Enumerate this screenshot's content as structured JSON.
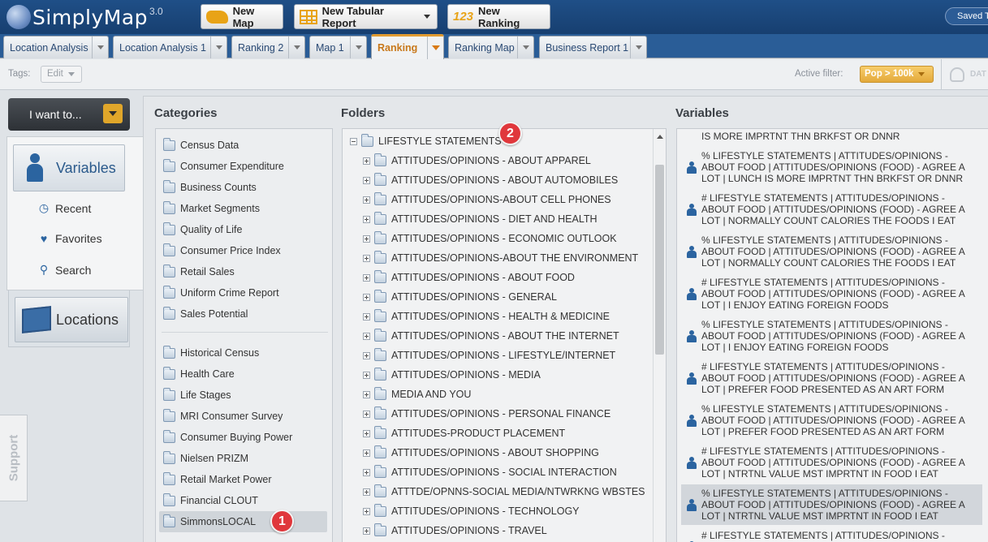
{
  "app": {
    "name": "SimplyMap",
    "version": "3.0"
  },
  "toolbar": {
    "new_map": "New Map",
    "new_tabular": "New Tabular Report",
    "new_ranking": "New Ranking",
    "new_ranking_icon_text": "123",
    "saved": "Saved T"
  },
  "tabs": [
    {
      "label": "Location Analysis"
    },
    {
      "label": "Location Analysis 1"
    },
    {
      "label": "Ranking 2"
    },
    {
      "label": "Map 1"
    },
    {
      "label": "Ranking"
    },
    {
      "label": "Ranking Map"
    },
    {
      "label": "Business Report 1"
    }
  ],
  "filterbar": {
    "tags_label": "Tags:",
    "tags_edit": "Edit",
    "active_filter_label": "Active filter:",
    "active_filter_value": "Pop > 100k",
    "data_label": "DAT"
  },
  "nav": {
    "i_want": "I want to...",
    "variables": "Variables",
    "recent": "Recent",
    "favorites": "Favorites",
    "search": "Search",
    "locations": "Locations",
    "support": "Support"
  },
  "columns": {
    "categories": "Categories",
    "folders": "Folders",
    "variables": "Variables"
  },
  "categories_top": [
    "Census Data",
    "Consumer Expenditure",
    "Business Counts",
    "Market Segments",
    "Quality of Life",
    "Consumer Price Index",
    "Retail Sales",
    "Uniform Crime Report",
    "Sales Potential"
  ],
  "categories_bottom": [
    "Historical Census",
    "Health Care",
    "Life Stages",
    "MRI Consumer Survey",
    "Consumer Buying Power",
    "Nielsen PRIZM",
    "Retail Market Power",
    "Financial CLOUT",
    "SimmonsLOCAL"
  ],
  "folders": {
    "root": "LIFESTYLE STATEMENTS",
    "items": [
      "ATTITUDES/OPINIONS - ABOUT APPAREL",
      "ATTITUDES/OPINIONS - ABOUT AUTOMOBILES",
      "ATTITUDES/OPINIONS-ABOUT CELL PHONES",
      "ATTITUDES/OPINIONS - DIET AND HEALTH",
      "ATTITUDES/OPINIONS - ECONOMIC OUTLOOK",
      "ATTITUDES/OPINIONS-ABOUT THE ENVIRONMENT",
      "ATTITUDES/OPINIONS - ABOUT FOOD",
      "ATTITUDES/OPINIONS - GENERAL",
      "ATTITUDES/OPINIONS - HEALTH & MEDICINE",
      "ATTITUDES/OPINIONS - ABOUT THE INTERNET",
      "ATTITUDES/OPINIONS - LIFESTYLE/INTERNET",
      "ATTITUDES/OPINIONS - MEDIA",
      "MEDIA AND YOU",
      "ATTITUDES/OPINIONS - PERSONAL FINANCE",
      "ATTITUDES-PRODUCT PLACEMENT",
      "ATTITUDES/OPINIONS - ABOUT SHOPPING",
      "ATTITUDES/OPINIONS - SOCIAL INTERACTION",
      "ATTTDE/OPNNS-SOCIAL MEDIA/NTWRKNG WBSTES",
      "ATTITUDES/OPINIONS - TECHNOLOGY",
      "ATTITUDES/OPINIONS - TRAVEL"
    ]
  },
  "variables_partial_top": "IS MORE IMPRTNT THN BRKFST OR DNNR",
  "variables": [
    "% LIFESTYLE STATEMENTS | ATTITUDES/OPINIONS - ABOUT FOOD | ATTITUDES/OPINIONS (FOOD) - AGREE A LOT | LUNCH IS MORE IMPRTNT THN BRKFST OR DNNR",
    "# LIFESTYLE STATEMENTS | ATTITUDES/OPINIONS - ABOUT FOOD | ATTITUDES/OPINIONS (FOOD) - AGREE A LOT | NORMALLY COUNT CALORIES THE FOODS I EAT",
    "% LIFESTYLE STATEMENTS | ATTITUDES/OPINIONS - ABOUT FOOD | ATTITUDES/OPINIONS (FOOD) - AGREE A LOT | NORMALLY COUNT CALORIES THE FOODS I EAT",
    "# LIFESTYLE STATEMENTS | ATTITUDES/OPINIONS - ABOUT FOOD | ATTITUDES/OPINIONS (FOOD) - AGREE A LOT | I ENJOY EATING FOREIGN FOODS",
    "% LIFESTYLE STATEMENTS | ATTITUDES/OPINIONS - ABOUT FOOD | ATTITUDES/OPINIONS (FOOD) - AGREE A LOT | I ENJOY EATING FOREIGN FOODS",
    "# LIFESTYLE STATEMENTS | ATTITUDES/OPINIONS - ABOUT FOOD | ATTITUDES/OPINIONS (FOOD) - AGREE A LOT | PREFER FOOD PRESENTED AS AN ART FORM",
    "% LIFESTYLE STATEMENTS | ATTITUDES/OPINIONS - ABOUT FOOD | ATTITUDES/OPINIONS (FOOD) - AGREE A LOT | PREFER FOOD PRESENTED AS AN ART FORM",
    "# LIFESTYLE STATEMENTS | ATTITUDES/OPINIONS - ABOUT FOOD | ATTITUDES/OPINIONS (FOOD) - AGREE A LOT | NTRTNL VALUE MST IMPRTNT IN FOOD I EAT",
    "% LIFESTYLE STATEMENTS | ATTITUDES/OPINIONS - ABOUT FOOD | ATTITUDES/OPINIONS (FOOD) - AGREE A LOT | NTRTNL VALUE MST IMPRTNT IN FOOD I EAT",
    "# LIFESTYLE STATEMENTS | ATTITUDES/OPINIONS - ABOUT"
  ],
  "badges": {
    "one": "1",
    "two": "2"
  },
  "colors": {
    "accent": "#e09a30",
    "brand": "#1f4f87",
    "badge": "#e0373c",
    "link": "#2b64a0"
  }
}
